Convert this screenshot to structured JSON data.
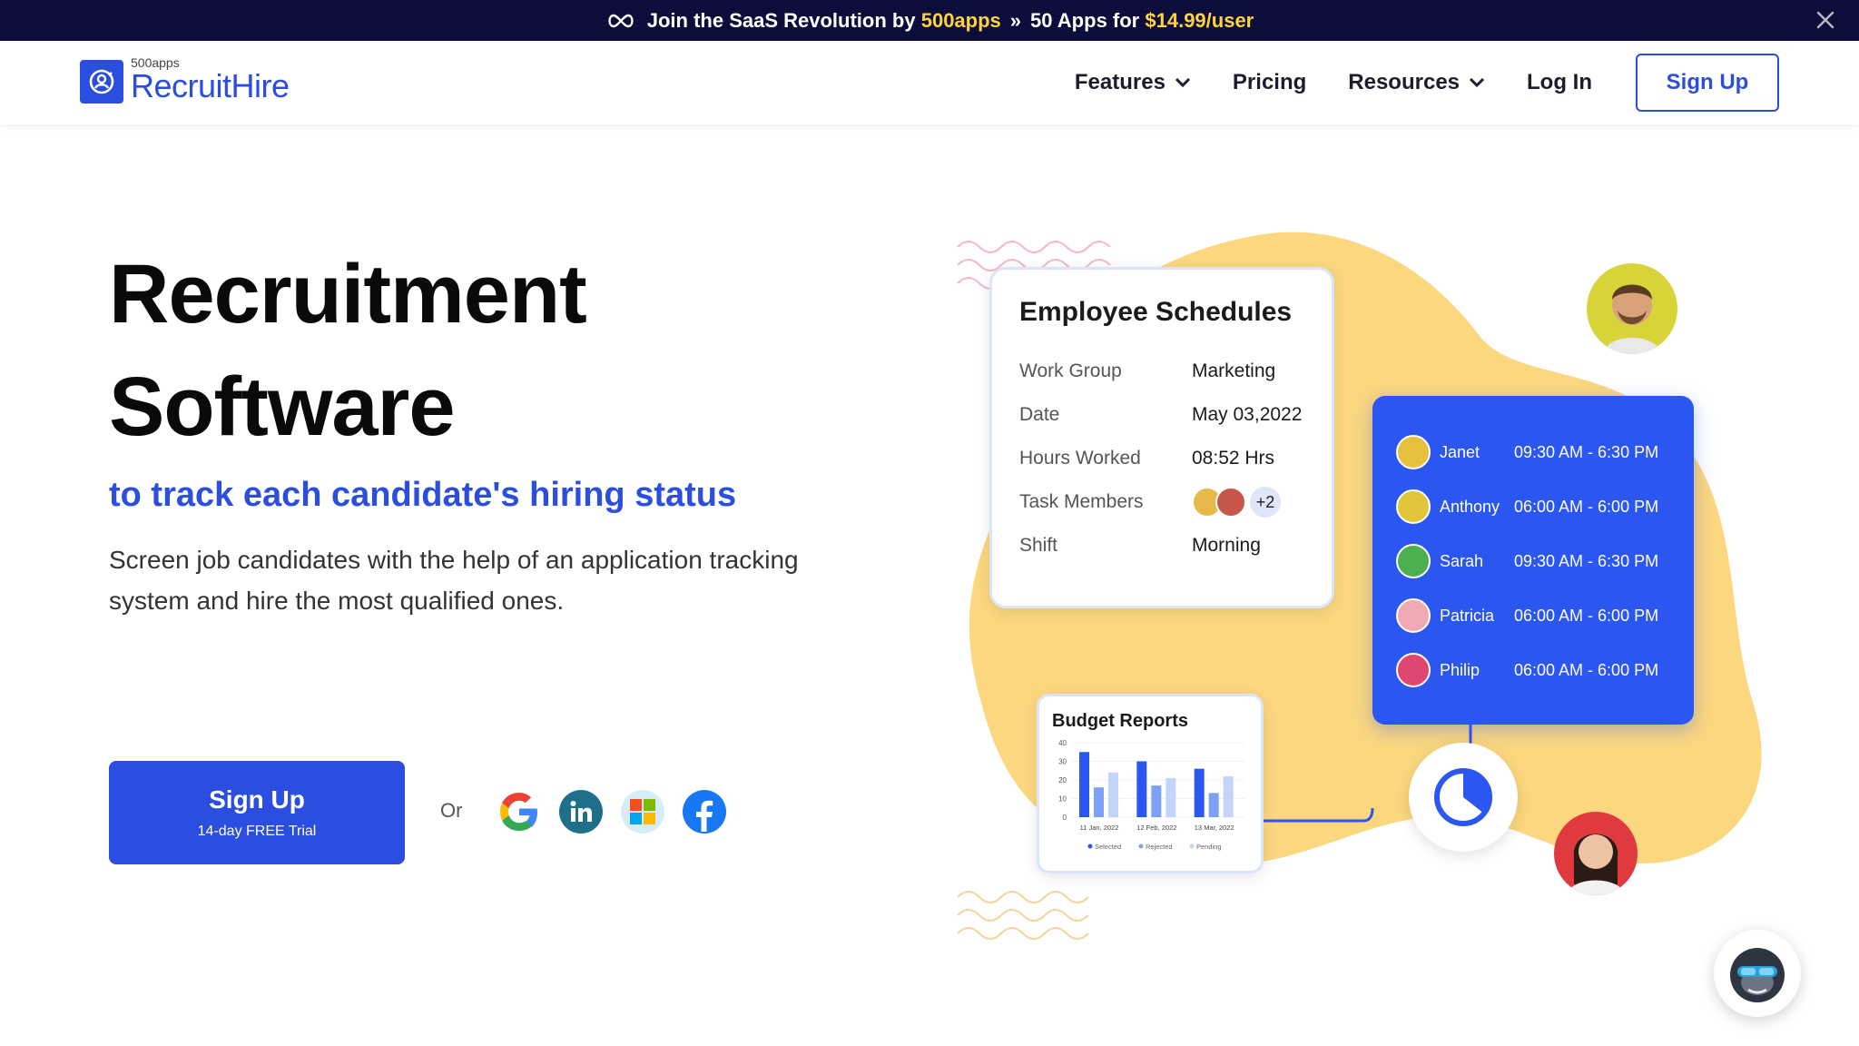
{
  "banner": {
    "text_a": "Join the SaaS Revolution by",
    "brand": "500apps",
    "sep": "»",
    "text_b": "50 Apps for",
    "price": "$14.99/user"
  },
  "header": {
    "logo_small": "500apps",
    "logo_big": "RecruitHire",
    "nav": {
      "features": "Features",
      "pricing": "Pricing",
      "resources": "Resources",
      "login": "Log In",
      "signup": "Sign Up"
    }
  },
  "hero": {
    "title_line1": "Recruitment",
    "title_line2": "Software",
    "subtitle": "to track each candidate's hiring status",
    "description": "Screen job candidates with the help of an application tracking system and hire the most qualified ones.",
    "cta_main": "Sign Up",
    "cta_note": "14-day FREE Trial",
    "or": "Or"
  },
  "schedule_card": {
    "title": "Employee Schedules",
    "rows": [
      {
        "key": "Work Group",
        "value": "Marketing"
      },
      {
        "key": "Date",
        "value": "May 03,2022"
      },
      {
        "key": "Hours Worked",
        "value": "08:52 Hrs"
      },
      {
        "key": "Task Members",
        "value": "+2"
      },
      {
        "key": "Shift",
        "value": "Morning"
      }
    ]
  },
  "shift_list": [
    {
      "name": "Janet",
      "time": "09:30 AM - 6:30 PM"
    },
    {
      "name": "Anthony",
      "time": "06:00 AM - 6:00 PM"
    },
    {
      "name": "Sarah",
      "time": "09:30 AM - 6:30 PM"
    },
    {
      "name": "Patricia",
      "time": "06:00 AM - 6:00 PM"
    },
    {
      "name": "Philip",
      "time": "06:00 AM - 6:00 PM"
    }
  ],
  "budget": {
    "title": "Budget Reports"
  },
  "chart_data": {
    "type": "bar",
    "title": "Budget Reports",
    "categories": [
      "11 Jan, 2022",
      "12 Feb, 2022",
      "13 Mar, 2022"
    ],
    "ylim": [
      0,
      40
    ],
    "yticks": [
      "40",
      "30",
      "20",
      "10",
      "0"
    ],
    "series": [
      {
        "name": "Selected",
        "values": [
          35,
          30,
          26
        ]
      },
      {
        "name": "Rejected",
        "values": [
          16,
          17,
          13
        ]
      },
      {
        "name": "Pending",
        "values": [
          24,
          21,
          22
        ]
      }
    ],
    "colors": [
      "#2b56f0",
      "#7ea0f5",
      "#c5d4fb"
    ]
  },
  "colors": {
    "brand_blue": "#2b4ee0",
    "banner_bg": "#0d0d3b",
    "highlight": "#ffd43b",
    "blob": "#fbd77f"
  },
  "icons": {
    "social": [
      "google-icon",
      "linkedin-icon",
      "microsoft-icon",
      "facebook-icon"
    ]
  }
}
